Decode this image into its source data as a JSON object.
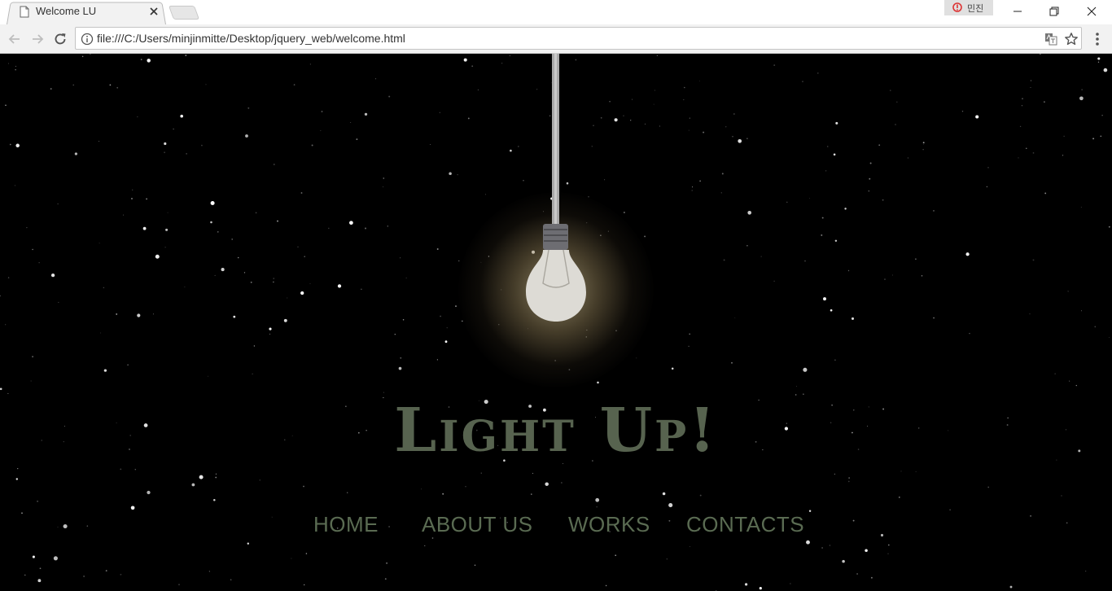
{
  "browser": {
    "tab_title": "Welcome LU",
    "profile_name": "민진",
    "url": "file:///C:/Users/minjinmitte/Desktop/jquery_web/welcome.html"
  },
  "page": {
    "title": "Light Up!",
    "nav": [
      {
        "label": "HOME"
      },
      {
        "label": "ABOUT US"
      },
      {
        "label": "WORKS"
      },
      {
        "label": "CONTACTS"
      }
    ]
  },
  "colors": {
    "background": "#000000",
    "title": "#57634f",
    "nav_text": "#5a6b52",
    "bulb": "#dddbd5"
  }
}
